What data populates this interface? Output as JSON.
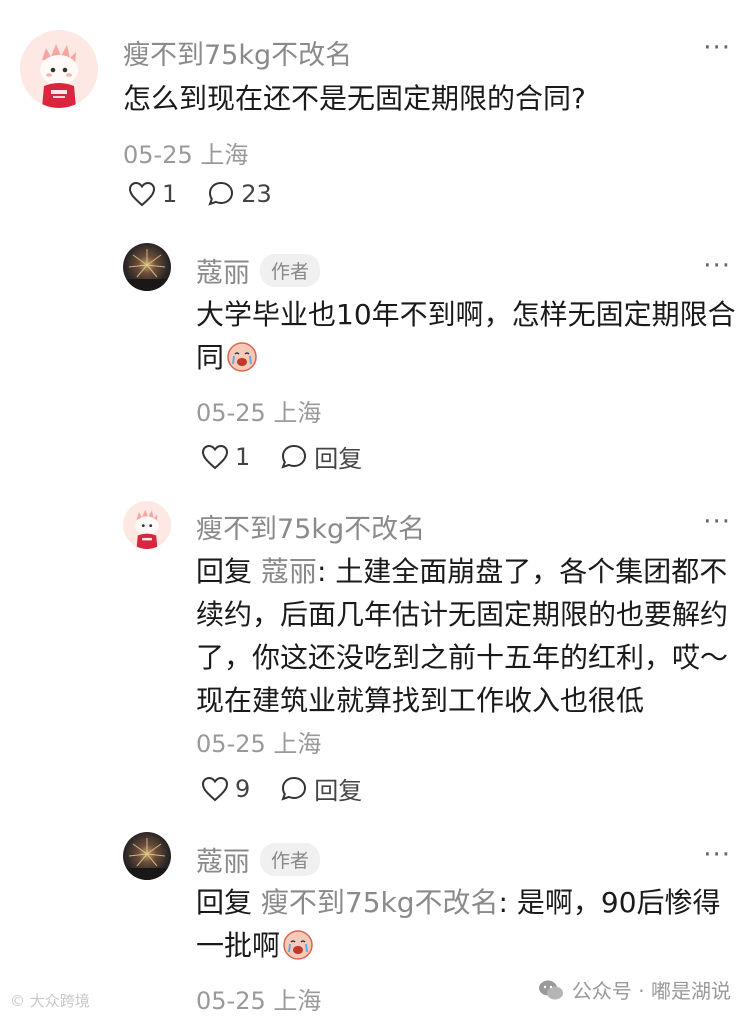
{
  "comments": [
    {
      "user": "瘦不到75kg不改名",
      "text": "怎么到现在还不是无固定期限的合同?",
      "date": "05-25 上海",
      "likes": "1",
      "replies": "23",
      "more": "···"
    },
    {
      "user": "蔻丽",
      "badge": "作者",
      "text_line1": "大学毕业也10年不到啊，怎样无固定期限合",
      "text_line2": "同",
      "date": "05-25 上海",
      "likes": "1",
      "reply_label": "回复",
      "more": "···"
    },
    {
      "user": "瘦不到75kg不改名",
      "reply_prefix": "回复",
      "reply_target": "蔻丽",
      "line1_rest": ": 土建全面崩盘了，各个集团都不",
      "line2": "续约，后面几年估计无固定期限的也要解约",
      "line3": "了，你这还没吃到之前十五年的红利，哎～",
      "line4": "现在建筑业就算找到工作收入也很低",
      "date": "05-25 上海",
      "likes": "9",
      "reply_label": "回复",
      "more": "···"
    },
    {
      "user": "蔻丽",
      "badge": "作者",
      "reply_prefix": "回复",
      "reply_target": "瘦不到75kg不改名",
      "line1_rest": ": 是啊，90后惨得",
      "line2": "一批啊",
      "date": "05-25 上海",
      "more": "···"
    }
  ],
  "watermark_left": "© 大众跨境",
  "watermark_right": "公众号 · 嘟是湖说",
  "colors": {
    "text": "#1a1a1a",
    "muted": "#8a8a8a",
    "badge_bg": "#f0f0f0",
    "bg": "#ffffff"
  }
}
